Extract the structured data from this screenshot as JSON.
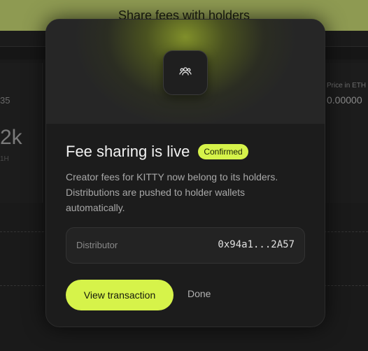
{
  "background": {
    "banner_title": "Share fees with holders",
    "left_small": "35",
    "left_big": "2k",
    "left_tiny": "1H",
    "price_label": "Price in ETH",
    "price_value": "0.00000"
  },
  "modal": {
    "icon": "users-icon",
    "title": "Fee sharing is live",
    "badge": "Confirmed",
    "description": "Creator fees for KITTY now belong to its holders. Distributions are pushed to holder wallets automatically.",
    "distributor_label": "Distributor",
    "distributor_value": "0x94a1...2A57",
    "primary_button": "View transaction",
    "secondary_button": "Done"
  },
  "colors": {
    "accent": "#d6f34a",
    "banner": "#8e9a52",
    "modal_bg": "#1c1c1c"
  }
}
